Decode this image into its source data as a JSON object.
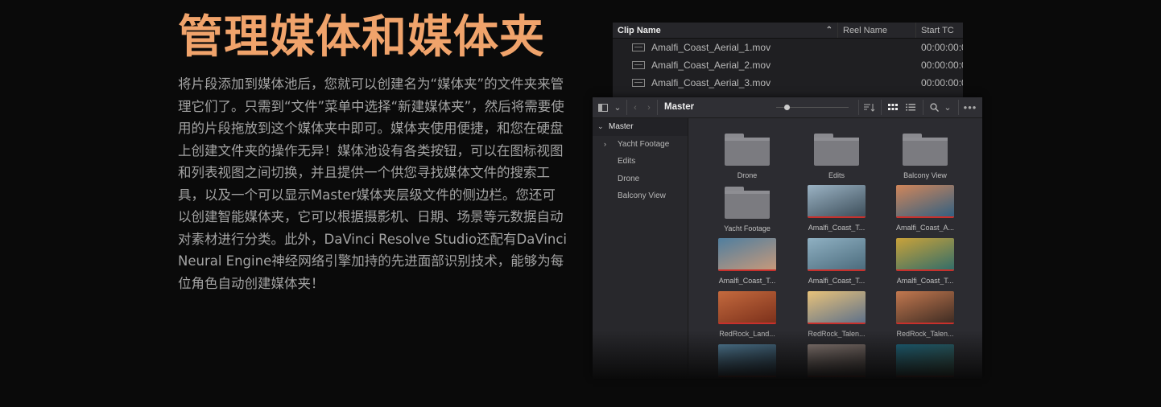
{
  "headline": "管理媒体和媒体夹",
  "body": "将片段添加到媒体池后，您就可以创建名为“媒体夹”的文件夹来管理它们了。只需到“文件”菜单中选择“新建媒体夹”，然后将需要使用的片段拖放到这个媒体夹中即可。媒体夹使用便捷，和您在硬盘上创建文件夹的操作无异！媒体池设有各类按钮，可以在图标视图和列表视图之间切换，并且提供一个供您寻找媒体文件的搜索工具，以及一个可以显示Master媒体夹层级文件的侧边栏。您还可以创建智能媒体夹，它可以根据摄影机、日期、场景等元数据自动对素材进行分类。此外，DaVinci Resolve Studio还配有DaVinci Neural Engine神经网络引擎加持的先进面部识别技术，能够为每位角色自动创建媒体夹！",
  "list_view": {
    "columns": [
      "Clip Name",
      "Reel Name",
      "Start TC"
    ],
    "rows": [
      {
        "name": "Amalfi_Coast_Aerial_1.mov",
        "start_tc": "00:00:00:0"
      },
      {
        "name": "Amalfi_Coast_Aerial_2.mov",
        "start_tc": "00:00:00:0"
      },
      {
        "name": "Amalfi_Coast_Aerial_3.mov",
        "start_tc": "00:00:00:0"
      }
    ]
  },
  "media_pool": {
    "title": "Master",
    "sidebar": {
      "root": "Master",
      "items": [
        "Yacht Footage",
        "Edits",
        "Drone",
        "Balcony View"
      ]
    },
    "zoom_level": 0.15,
    "tiles": [
      {
        "label": "Drone",
        "kind": "folder"
      },
      {
        "label": "Edits",
        "kind": "folder"
      },
      {
        "label": "Balcony View",
        "kind": "folder"
      },
      {
        "label": "Yacht Footage",
        "kind": "folder"
      },
      {
        "label": "Amalfi_Coast_T...",
        "kind": "clip",
        "colors": [
          "#9bb3c4",
          "#3a4b57"
        ]
      },
      {
        "label": "Amalfi_Coast_A...",
        "kind": "clip",
        "colors": [
          "#d1865a",
          "#2e5f82"
        ]
      },
      {
        "label": "Amalfi_Coast_T...",
        "kind": "clip",
        "colors": [
          "#4f7e9f",
          "#c99a7a"
        ]
      },
      {
        "label": "Amalfi_Coast_T...",
        "kind": "clip",
        "colors": [
          "#8fb0c2",
          "#4a6a7b"
        ]
      },
      {
        "label": "Amalfi_Coast_T...",
        "kind": "clip",
        "colors": [
          "#c9a23a",
          "#2f6c6a"
        ]
      },
      {
        "label": "RedRock_Land...",
        "kind": "clip",
        "colors": [
          "#c46a3e",
          "#7a2f1a"
        ]
      },
      {
        "label": "RedRock_Talen...",
        "kind": "clip",
        "colors": [
          "#e8c27a",
          "#5b6f8a"
        ]
      },
      {
        "label": "RedRock_Talen...",
        "kind": "clip",
        "colors": [
          "#c2784f",
          "#3b2a22"
        ]
      },
      {
        "label": "",
        "kind": "clip",
        "colors": [
          "#5d8fae",
          "#2a3d4c"
        ]
      },
      {
        "label": "",
        "kind": "clip",
        "colors": [
          "#9a8a84",
          "#4e4542"
        ]
      },
      {
        "label": "",
        "kind": "clip",
        "colors": [
          "#1f6f8b",
          "#3c5a4a"
        ]
      }
    ]
  }
}
